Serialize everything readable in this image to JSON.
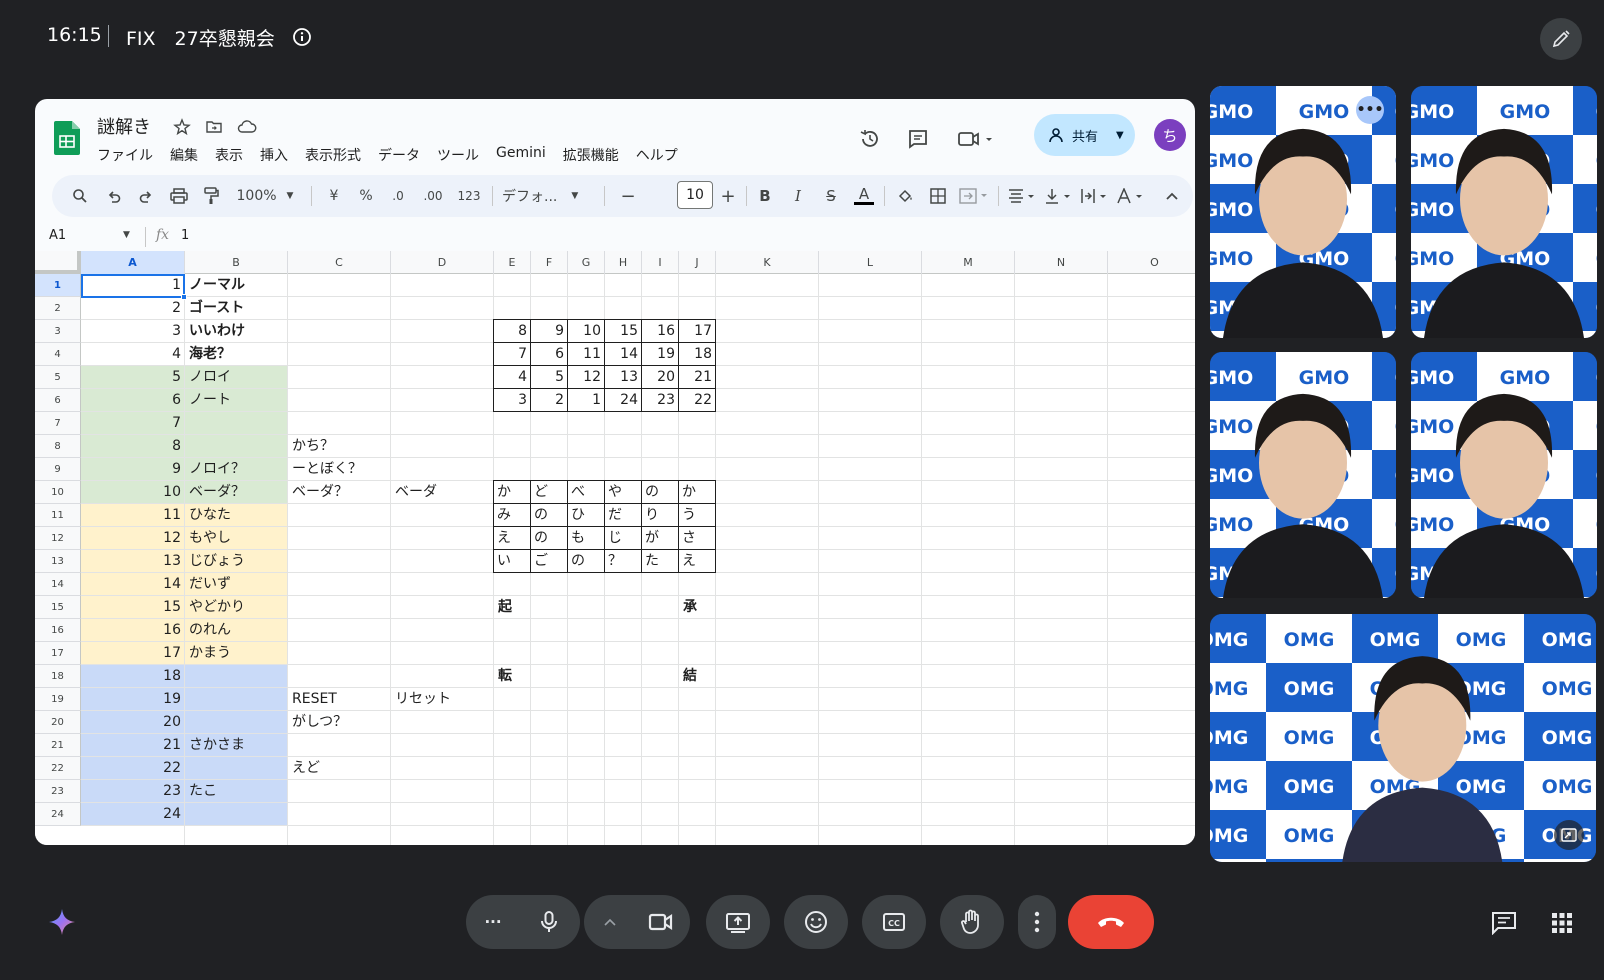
{
  "meet": {
    "time": "16:15",
    "title": "FIX　27卒懇親会"
  },
  "sheet": {
    "doc_title": "謎解き",
    "menu": [
      "ファイル",
      "編集",
      "表示",
      "挿入",
      "表示形式",
      "データ",
      "ツール",
      "Gemini",
      "拡張機能",
      "ヘルプ"
    ],
    "share_label": "共有",
    "avatar_letter": "ち",
    "toolbar": {
      "zoom": "100%",
      "currency": "¥",
      "percent": "%",
      "dec_decrease": ".0",
      "dec_increase": ".00",
      "number_format": "123",
      "font": "デフォ...",
      "font_size": "10",
      "minus": "−",
      "plus": "+",
      "bold": "B",
      "italic": "I",
      "strike": "S",
      "text_color": "A"
    },
    "name_box": "A1",
    "formula_value": "1",
    "columns": [
      "A",
      "B",
      "C",
      "D",
      "E",
      "F",
      "G",
      "H",
      "I",
      "J",
      "K",
      "L",
      "M",
      "N",
      "O"
    ],
    "rows": [
      "1",
      "2",
      "3",
      "4",
      "5",
      "6",
      "7",
      "8",
      "9",
      "10",
      "11",
      "12",
      "13",
      "14",
      "15",
      "16",
      "17",
      "18",
      "19",
      "20",
      "21",
      "22",
      "23",
      "24"
    ],
    "colA": [
      "1",
      "2",
      "3",
      "4",
      "5",
      "6",
      "7",
      "8",
      "9",
      "10",
      "11",
      "12",
      "13",
      "14",
      "15",
      "16",
      "17",
      "18",
      "19",
      "20",
      "21",
      "22",
      "23",
      "24"
    ],
    "colB": [
      "ノーマル",
      "ゴースト",
      "いいわけ",
      "海老？",
      "ノロイ",
      "ノート",
      "",
      "",
      "ノロイ？",
      "ベーダ？",
      "ひなた",
      "もやし",
      "じびょう",
      "だいず",
      "やどかり",
      "のれん",
      "かまう",
      "",
      "",
      "",
      "さかさま",
      "",
      "たこ",
      ""
    ],
    "colC": {
      "8": "かち？",
      "9": "ーとぼく？",
      "10": "ベーダ？",
      "19": "RESET",
      "20": "がしつ？",
      "22": "えど"
    },
    "colD": {
      "10": "ベーダ",
      "19": "リセット"
    },
    "num_table": [
      [
        "8",
        "9",
        "10",
        "15",
        "16",
        "17"
      ],
      [
        "7",
        "6",
        "11",
        "14",
        "19",
        "18"
      ],
      [
        "4",
        "5",
        "12",
        "13",
        "20",
        "21"
      ],
      [
        "3",
        "2",
        "1",
        "24",
        "23",
        "22"
      ]
    ],
    "kana_table": [
      [
        "か",
        "ど",
        "べ",
        "や",
        "の",
        "か"
      ],
      [
        "み",
        "の",
        "ひ",
        "だ",
        "り",
        "う"
      ],
      [
        "え",
        "の",
        "も",
        "じ",
        "が",
        "さ"
      ],
      [
        "い",
        "ご",
        "の",
        "？",
        "た",
        "え"
      ]
    ],
    "kishoutenketsu": {
      "ki": "起",
      "shou": "承",
      "ten": "転",
      "ketsu": "結"
    },
    "colors": {
      "green": "#d9ead3",
      "yellow": "#fff2cc",
      "blue": "#c9daf8"
    }
  },
  "tiles": {
    "logo_text": "GMO",
    "logo_text_mirror": "OMG"
  },
  "icons": {
    "info": "info-icon",
    "mic": "mic-icon",
    "camera": "camera-icon",
    "present": "present-icon",
    "emoji": "emoji-icon",
    "captions": "captions-icon",
    "hand": "raise-hand-icon",
    "more": "more-vert-icon",
    "hangup": "hangup-icon",
    "chat": "chat-icon",
    "apps": "apps-icon"
  }
}
